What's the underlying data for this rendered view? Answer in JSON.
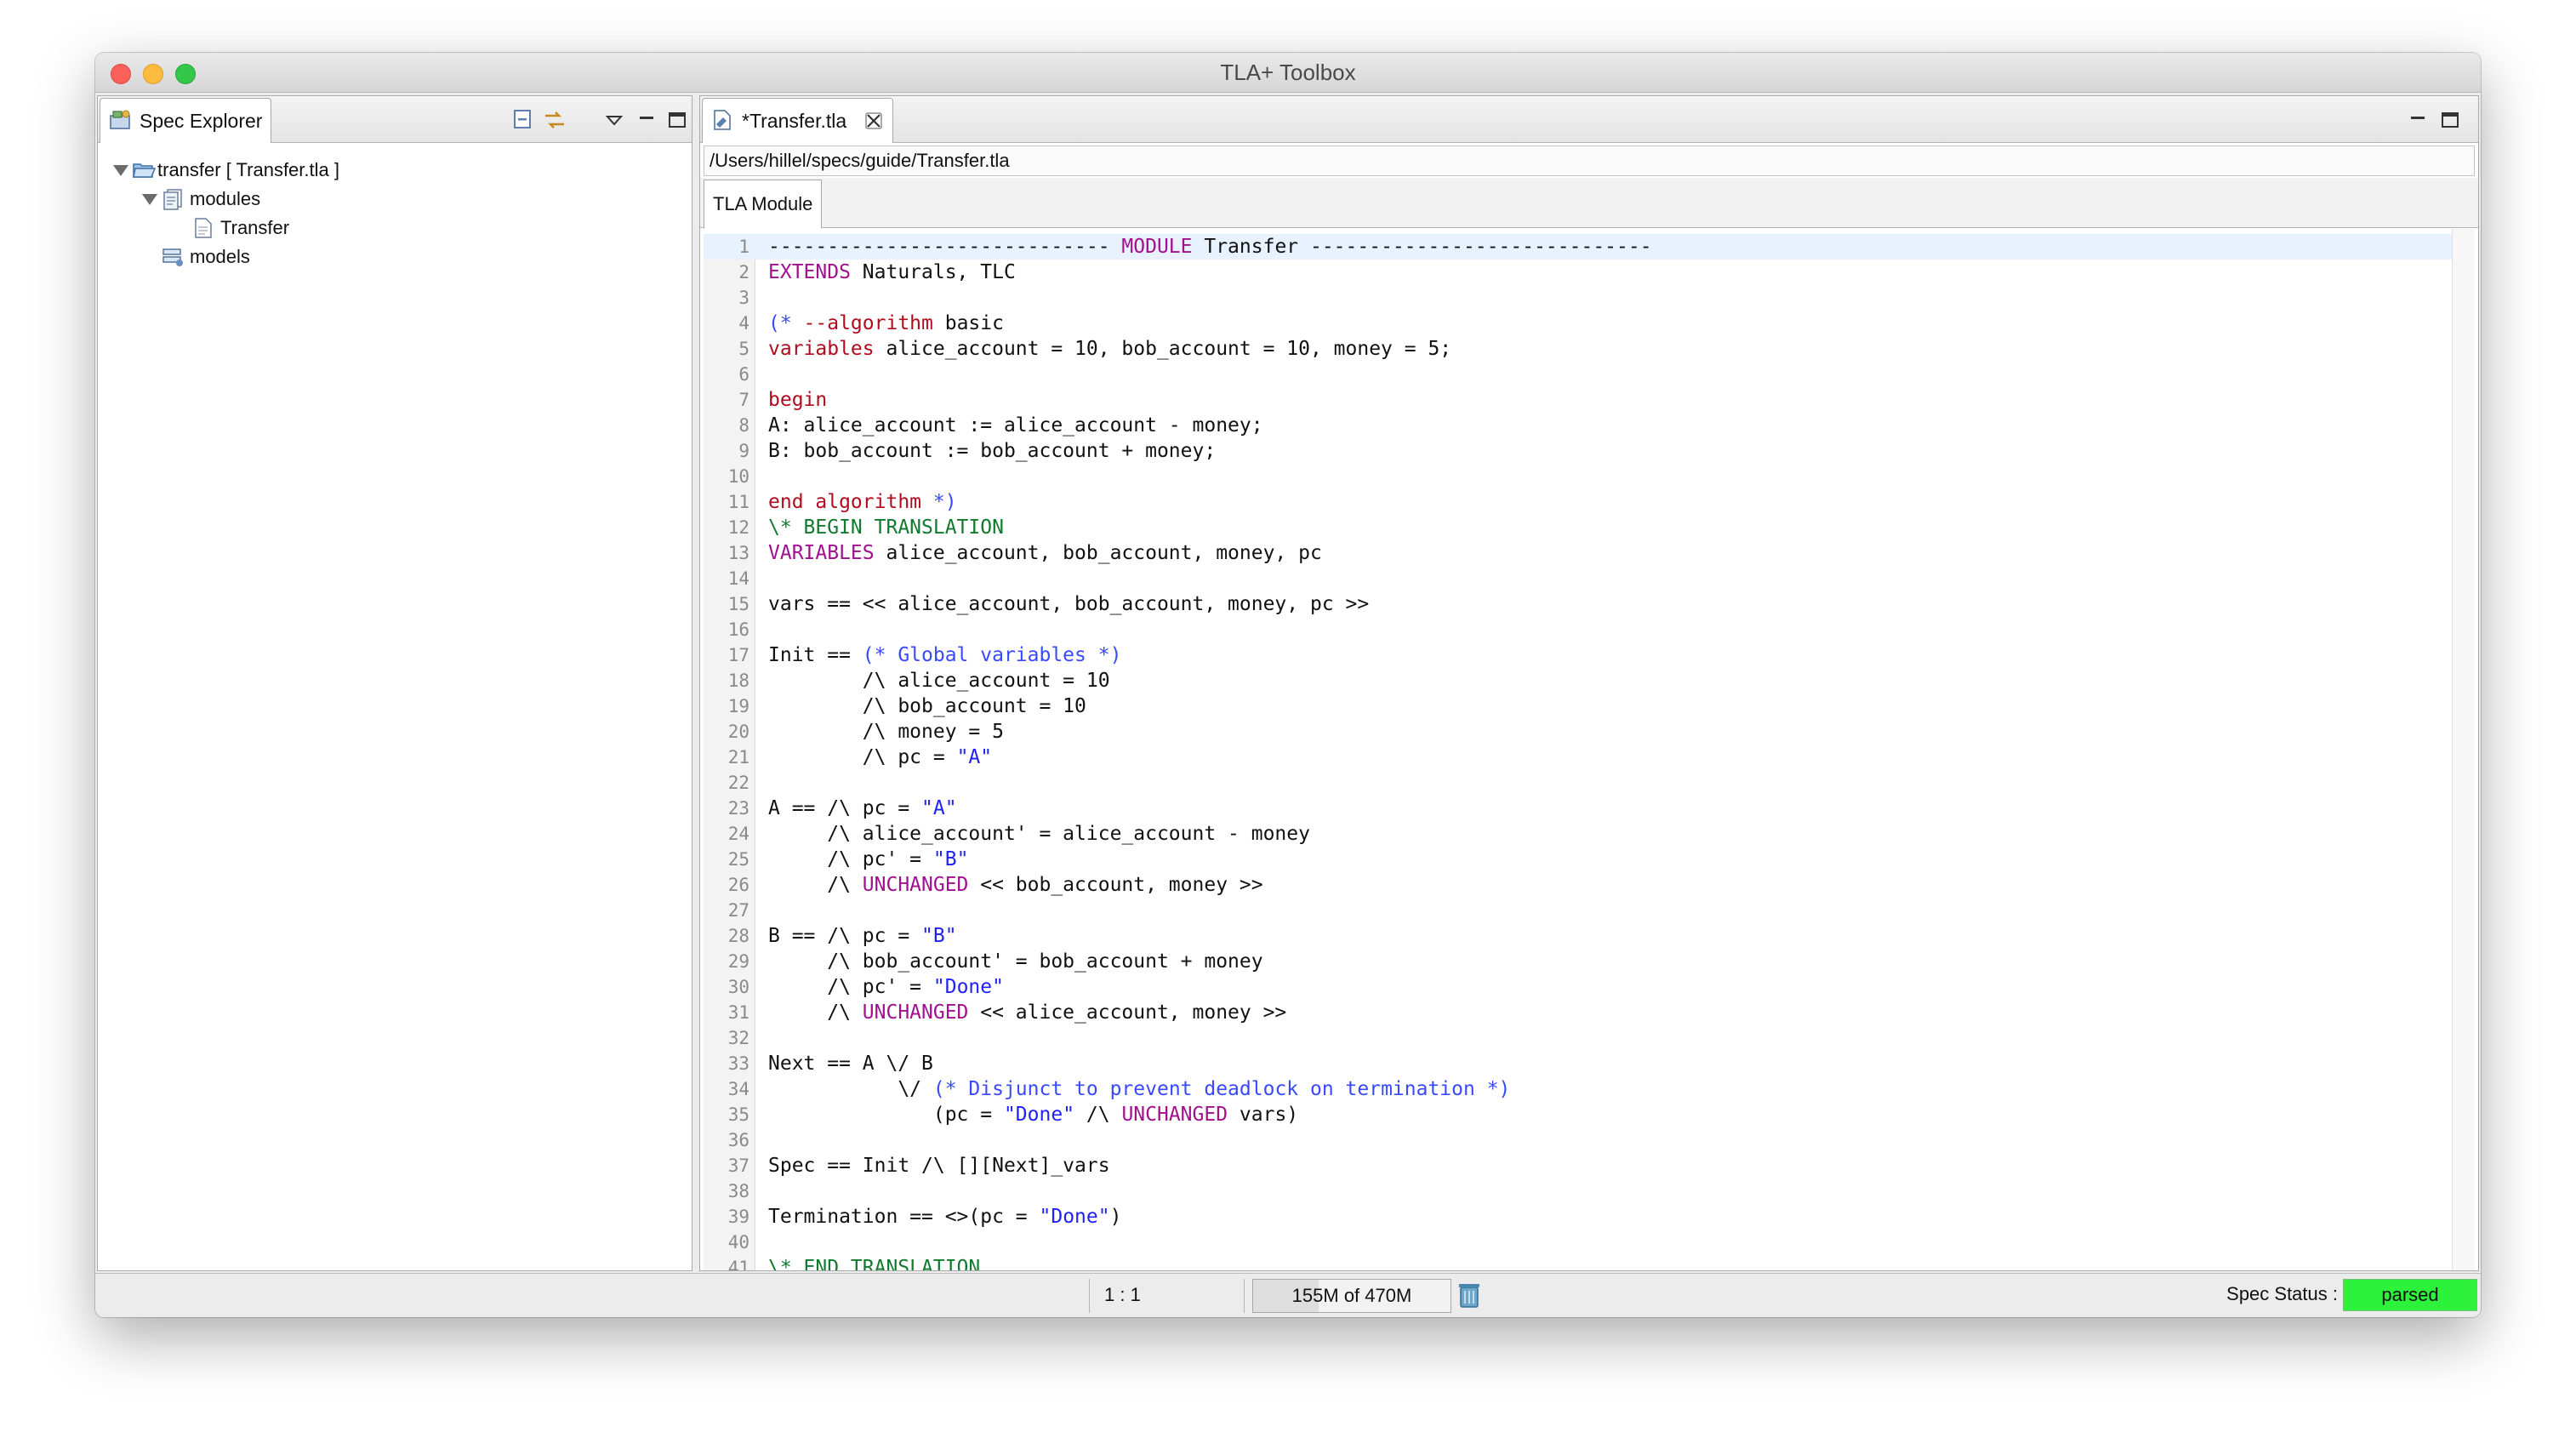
{
  "window": {
    "title": "TLA+ Toolbox"
  },
  "spec_explorer": {
    "tab_label": "Spec Explorer",
    "tree": [
      {
        "label": "transfer [ Transfer.tla ]",
        "depth": 0,
        "expanded": true,
        "icon": "folder-open-icon"
      },
      {
        "label": "modules",
        "depth": 1,
        "expanded": true,
        "icon": "modules-icon"
      },
      {
        "label": "Transfer",
        "depth": 2,
        "icon": "file-icon"
      },
      {
        "label": "models",
        "depth": 1,
        "icon": "models-icon"
      }
    ]
  },
  "editor": {
    "tab_label": "*Transfer.tla",
    "path": "/Users/hillel/specs/guide/Transfer.tla",
    "subtab_label": "TLA Module",
    "lines": [
      [
        {
          "t": "----------------------------- "
        },
        {
          "t": "MODULE",
          "c": "k-keyword"
        },
        {
          "t": " Transfer -----------------------------"
        }
      ],
      [
        {
          "t": "EXTENDS",
          "c": "k-keyword"
        },
        {
          "t": " Naturals, TLC"
        }
      ],
      [],
      [
        {
          "t": "(* ",
          "c": "k-comment"
        },
        {
          "t": "--algorithm",
          "c": "k-red"
        },
        {
          "t": " basic"
        }
      ],
      [
        {
          "t": "variables",
          "c": "k-red"
        },
        {
          "t": " alice_account = 10, bob_account = 10, money = 5;"
        }
      ],
      [],
      [
        {
          "t": "begin",
          "c": "k-red"
        }
      ],
      [
        {
          "t": "A: alice_account := alice_account - money;"
        }
      ],
      [
        {
          "t": "B: bob_account := bob_account + money;"
        }
      ],
      [],
      [
        {
          "t": "end algorithm",
          "c": "k-red"
        },
        {
          "t": " *)",
          "c": "k-comment"
        }
      ],
      [
        {
          "t": "\\* BEGIN TRANSLATION",
          "c": "k-green"
        }
      ],
      [
        {
          "t": "VARIABLES",
          "c": "k-keyword"
        },
        {
          "t": " alice_account, bob_account, money, pc"
        }
      ],
      [],
      [
        {
          "t": "vars == << alice_account, bob_account, money, pc >>"
        }
      ],
      [],
      [
        {
          "t": "Init == "
        },
        {
          "t": "(* Global variables *)",
          "c": "k-comment"
        }
      ],
      [
        {
          "t": "        /\\ alice_account = 10"
        }
      ],
      [
        {
          "t": "        /\\ bob_account = 10"
        }
      ],
      [
        {
          "t": "        /\\ money = 5"
        }
      ],
      [
        {
          "t": "        /\\ pc = "
        },
        {
          "t": "\"A\"",
          "c": "k-string"
        }
      ],
      [],
      [
        {
          "t": "A == /\\ pc = "
        },
        {
          "t": "\"A\"",
          "c": "k-string"
        }
      ],
      [
        {
          "t": "     /\\ alice_account' = alice_account - money"
        }
      ],
      [
        {
          "t": "     /\\ pc' = "
        },
        {
          "t": "\"B\"",
          "c": "k-string"
        }
      ],
      [
        {
          "t": "     /\\ "
        },
        {
          "t": "UNCHANGED",
          "c": "k-keyword"
        },
        {
          "t": " << bob_account, money >>"
        }
      ],
      [],
      [
        {
          "t": "B == /\\ pc = "
        },
        {
          "t": "\"B\"",
          "c": "k-string"
        }
      ],
      [
        {
          "t": "     /\\ bob_account' = bob_account + money"
        }
      ],
      [
        {
          "t": "     /\\ pc' = "
        },
        {
          "t": "\"Done\"",
          "c": "k-string"
        }
      ],
      [
        {
          "t": "     /\\ "
        },
        {
          "t": "UNCHANGED",
          "c": "k-keyword"
        },
        {
          "t": " << alice_account, money >>"
        }
      ],
      [],
      [
        {
          "t": "Next == A \\/ B"
        }
      ],
      [
        {
          "t": "           \\/ "
        },
        {
          "t": "(* Disjunct to prevent deadlock on termination *)",
          "c": "k-comment"
        }
      ],
      [
        {
          "t": "              (pc = "
        },
        {
          "t": "\"Done\"",
          "c": "k-string"
        },
        {
          "t": " /\\ "
        },
        {
          "t": "UNCHANGED",
          "c": "k-keyword"
        },
        {
          "t": " vars)"
        }
      ],
      [],
      [
        {
          "t": "Spec == Init /\\ [][Next]_vars"
        }
      ],
      [],
      [
        {
          "t": "Termination == <>(pc = "
        },
        {
          "t": "\"Done\"",
          "c": "k-string"
        },
        {
          "t": ")"
        }
      ],
      [],
      [
        {
          "t": "\\* END TRANSLATION",
          "c": "k-green"
        }
      ]
    ]
  },
  "status": {
    "cursor": "1 : 1",
    "heap": "155M of 470M",
    "heap_used_fraction": 0.33,
    "spec_status_label": "Spec Status :",
    "spec_status": "parsed",
    "spec_status_color": "#2cf23c"
  }
}
